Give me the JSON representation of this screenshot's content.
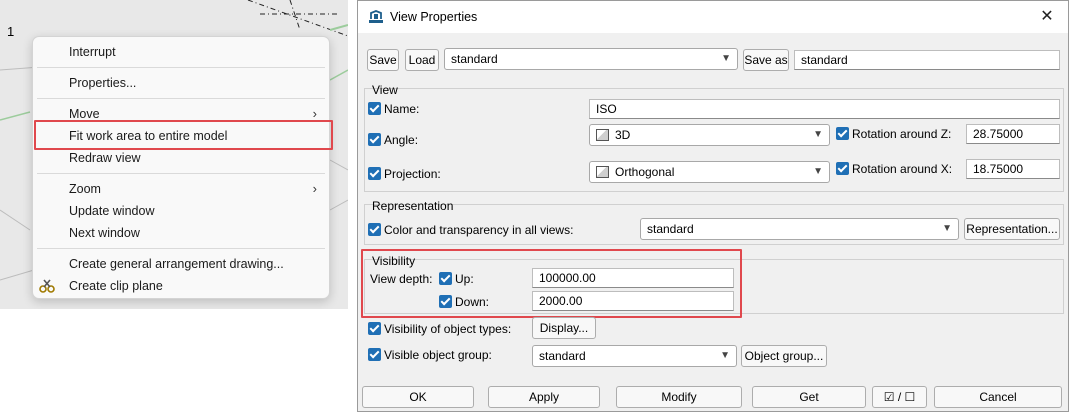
{
  "viewport": {
    "view_number": "1",
    "context_menu": {
      "items": [
        {
          "label": "Interrupt"
        },
        {
          "label": "Properties..."
        },
        {
          "label": "Move",
          "has_submenu": true
        },
        {
          "label": "Fit work area to entire model",
          "highlighted": true
        },
        {
          "label": "Redraw view"
        },
        {
          "label": "Zoom",
          "has_submenu": true
        },
        {
          "label": "Update window"
        },
        {
          "label": "Next window"
        },
        {
          "label": "Create general arrangement drawing..."
        },
        {
          "label": "Create clip plane",
          "icon": "clip-plane-icon"
        }
      ],
      "submenu_arrow": "›"
    }
  },
  "dialog": {
    "title": "View Properties",
    "title_icon": "view-properties-icon",
    "close_glyph": "✕",
    "toolbar": {
      "save_label": "Save",
      "load_label": "Load",
      "preset_value": "standard",
      "save_as_label": "Save as",
      "save_as_value": "standard"
    },
    "view_group": {
      "label": "View",
      "name_label": "Name:",
      "name_value": "ISO",
      "angle_label": "Angle:",
      "angle_value": "3D",
      "rotation_z_label": "Rotation around Z:",
      "rotation_z_value": "28.75000",
      "projection_label": "Projection:",
      "projection_value": "Orthogonal",
      "rotation_x_label": "Rotation around X:",
      "rotation_x_value": "18.75000"
    },
    "representation_group": {
      "label": "Representation",
      "color_label": "Color and transparency in all views:",
      "color_value": "standard",
      "representation_button": "Representation..."
    },
    "visibility_group": {
      "label": "Visibility",
      "view_depth_label": "View depth:",
      "up_label": "Up:",
      "up_value": "100000.00",
      "down_label": "Down:",
      "down_value": "2000.00"
    },
    "object_types_label": "Visibility of object types:",
    "display_button": "Display...",
    "object_group_label": "Visible object group:",
    "object_group_value": "standard",
    "object_group_button": "Object group...",
    "buttons": {
      "ok": "OK",
      "apply": "Apply",
      "modify": "Modify",
      "get": "Get",
      "toggle": "☑ / ☐",
      "cancel": "Cancel"
    }
  },
  "colors": {
    "highlight_border": "#e0484d",
    "checkbox_fill": "#1f6fb5",
    "dialog_bg": "#f0f0f0"
  }
}
